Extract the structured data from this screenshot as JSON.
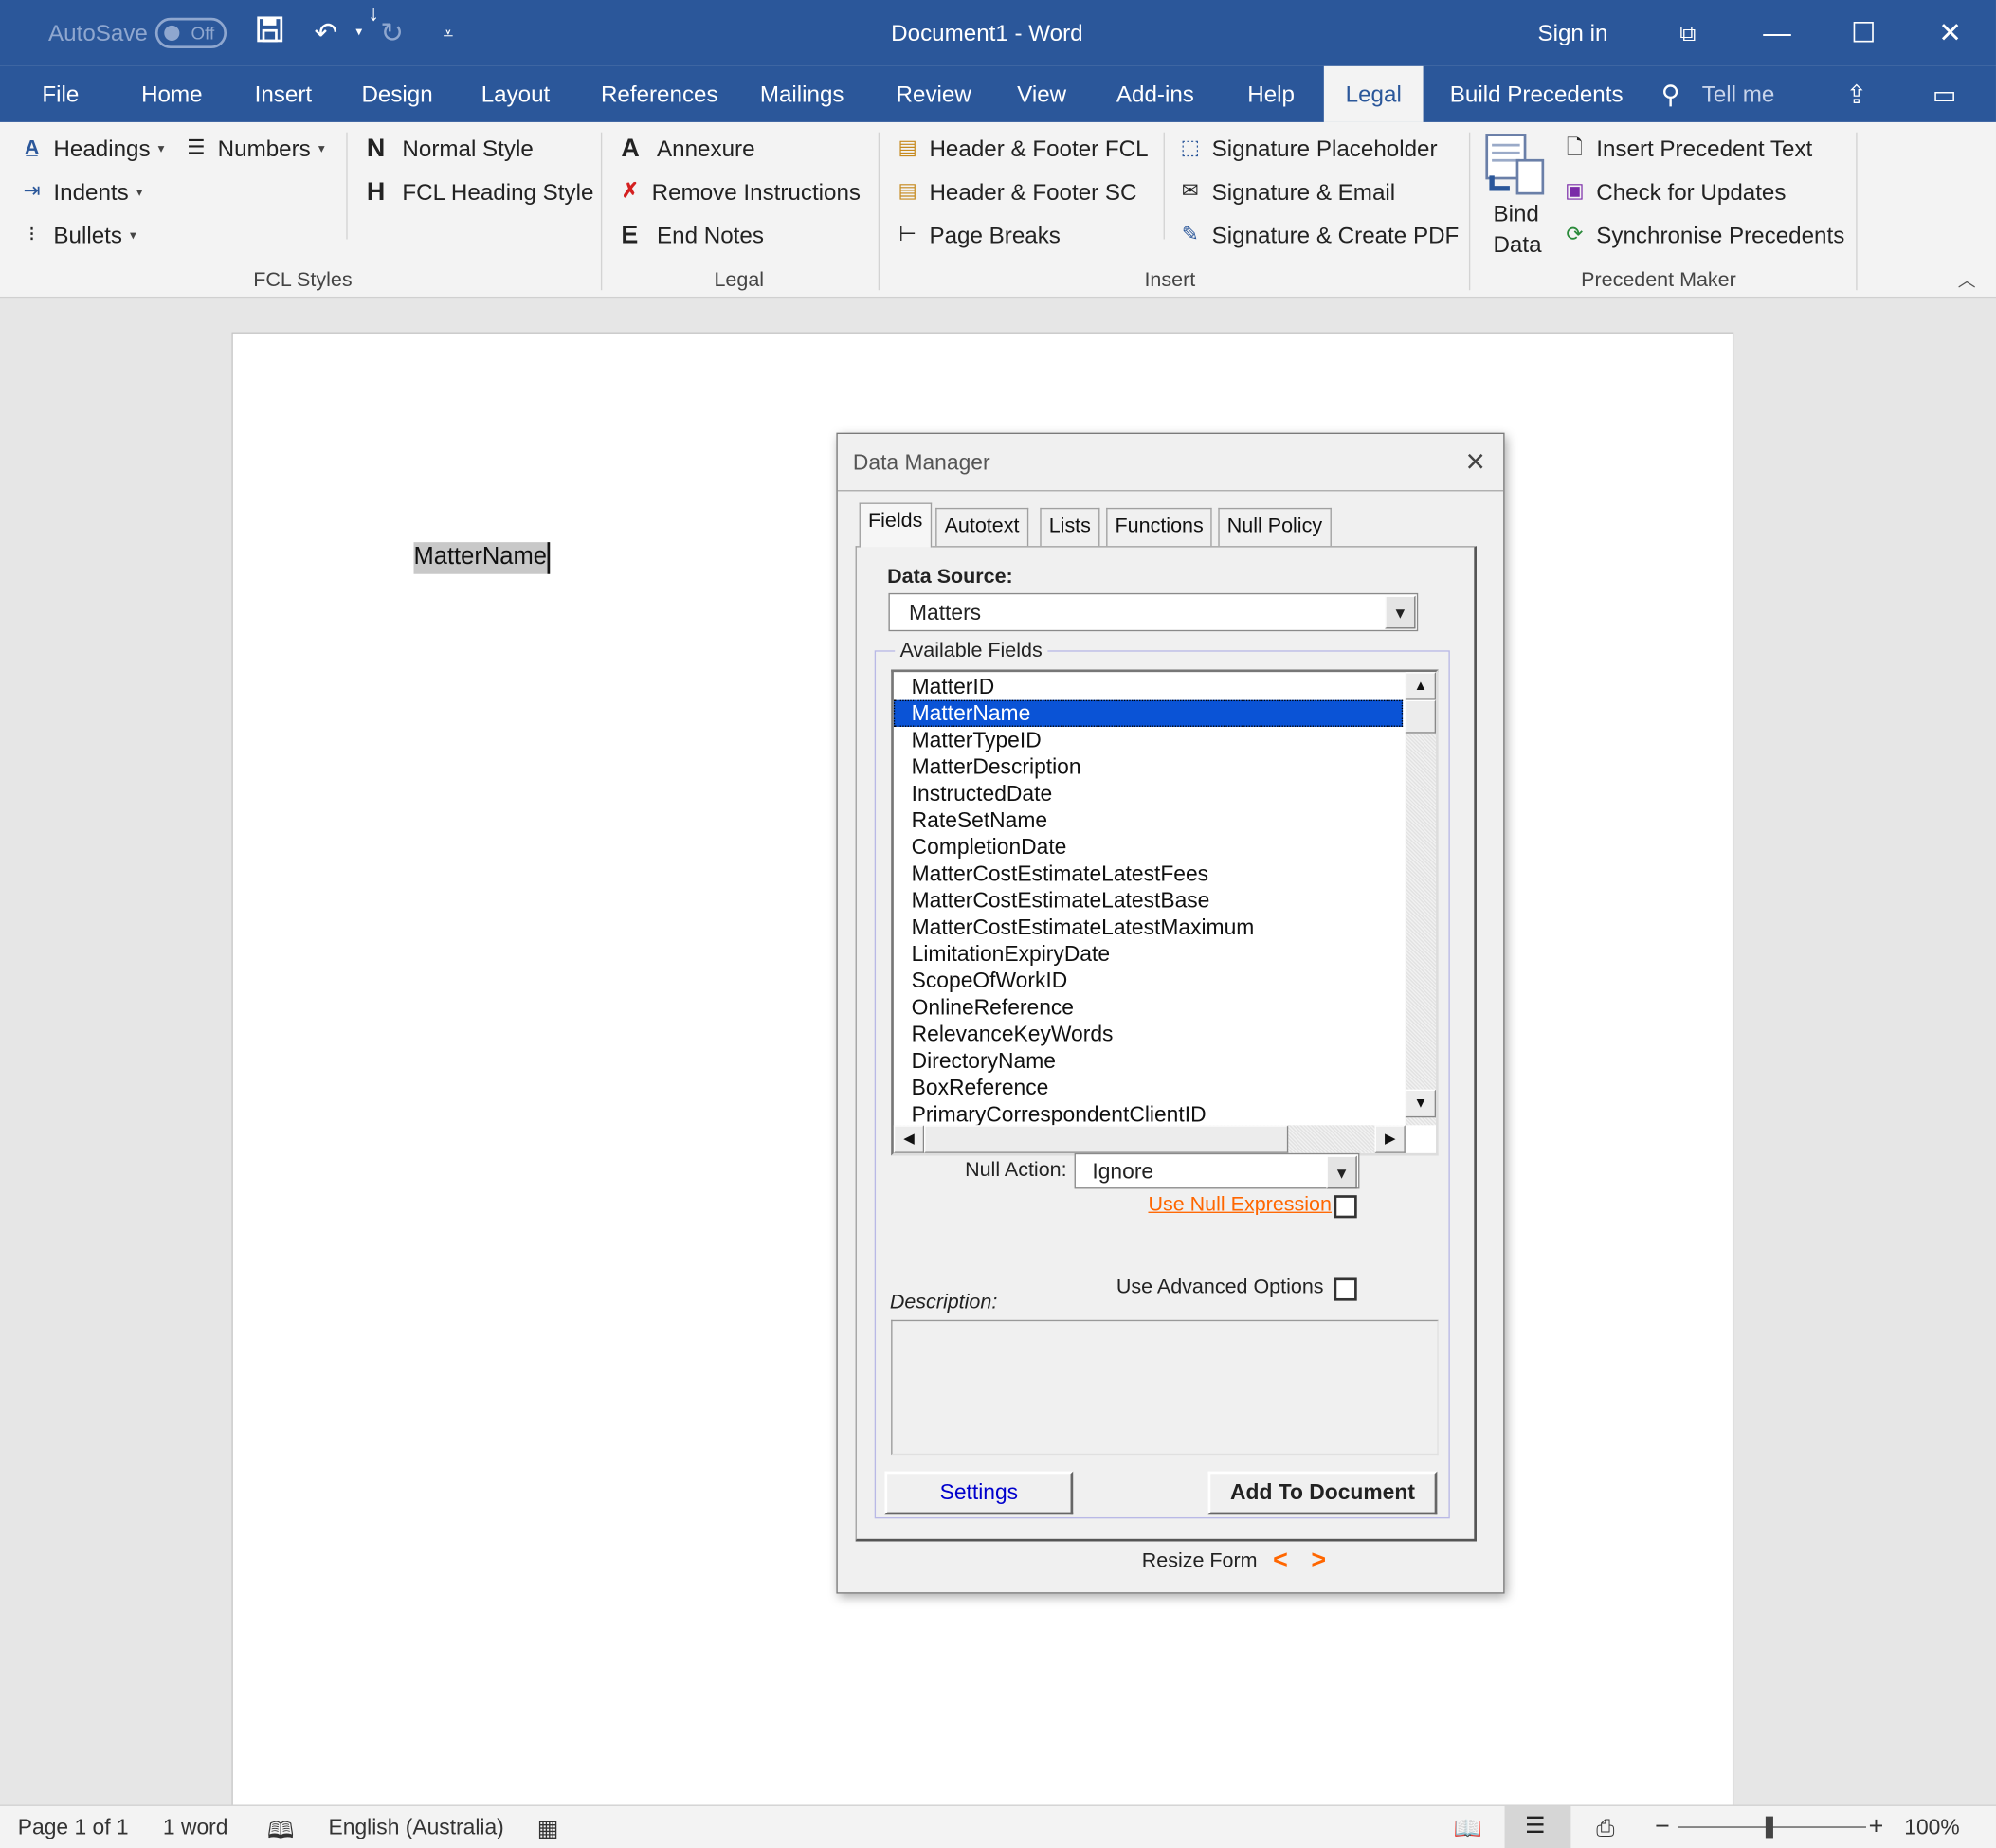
{
  "window": {
    "autosave_label": "AutoSave",
    "autosave_state": "Off",
    "title": "Document1  -  Word",
    "sign_in": "Sign in"
  },
  "ribbon_tabs": [
    "File",
    "Home",
    "Insert",
    "Design",
    "Layout",
    "References",
    "Mailings",
    "Review",
    "View",
    "Add-ins",
    "Help",
    "Legal",
    "Build Precedents"
  ],
  "active_tab": "Legal",
  "tell_me": "Tell me",
  "groups": {
    "fcl_styles": {
      "label": "FCL Styles",
      "headings": "Headings",
      "numbers": "Numbers",
      "indents": "Indents",
      "bullets": "Bullets",
      "normal_style_letter": "N",
      "normal_style": "Normal Style",
      "fcl_heading_letter": "H",
      "fcl_heading_style": "FCL Heading Style"
    },
    "legal": {
      "label": "Legal",
      "annexure_letter": "A",
      "annexure": "Annexure",
      "remove_instructions": "Remove Instructions",
      "end_notes_letter": "E",
      "end_notes": "End Notes"
    },
    "insert": {
      "label": "Insert",
      "header_footer_fcl": "Header & Footer FCL",
      "header_footer_sc": "Header & Footer SC",
      "page_breaks": "Page Breaks",
      "signature_placeholder": "Signature Placeholder",
      "signature_email": "Signature & Email",
      "signature_pdf": "Signature & Create PDF"
    },
    "precedent_maker": {
      "label": "Precedent Maker",
      "bind_data_1": "Bind",
      "bind_data_2": "Data",
      "insert_precedent_text": "Insert Precedent Text",
      "check_updates": "Check for Updates",
      "sync_precedents": "Synchronise Precedents"
    }
  },
  "document": {
    "field_text": "MatterName"
  },
  "dialog": {
    "title": "Data Manager",
    "tabs": [
      "Fields",
      "Autotext",
      "Lists",
      "Functions",
      "Null Policy"
    ],
    "active_tab": "Fields",
    "data_source_label": "Data Source:",
    "data_source_value": "Matters",
    "available_fields_label": "Available Fields",
    "fields": [
      "MatterID",
      "MatterName",
      "MatterTypeID",
      "MatterDescription",
      "InstructedDate",
      "RateSetName",
      "CompletionDate",
      "MatterCostEstimateLatestFees",
      "MatterCostEstimateLatestBase",
      "MatterCostEstimateLatestMaximum",
      "LimitationExpiryDate",
      "ScopeOfWorkID",
      "OnlineReference",
      "RelevanceKeyWords",
      "DirectoryName",
      "BoxReference",
      "PrimaryCorrespondentClientID"
    ],
    "selected_field": "MatterName",
    "null_action_label": "Null Action:",
    "null_action_value": "Ignore",
    "use_null_expression": "Use Null Expression",
    "use_null_expression_checked": false,
    "use_advanced_options": "Use Advanced Options",
    "use_advanced_options_checked": false,
    "description_label": "Description:",
    "description_value": "",
    "settings_button": "Settings",
    "add_button": "Add To Document",
    "resize_label": "Resize Form",
    "resize_left": "<",
    "resize_right": ">"
  },
  "status": {
    "page": "Page 1 of 1",
    "words": "1 word",
    "language": "English (Australia)",
    "zoom": "100%",
    "zoom_level_percent": 100
  },
  "colors": {
    "title_bar": "#2b579a",
    "selection": "#0a53d6",
    "link_orange": "#ff6600",
    "settings_blue": "#0000cc"
  }
}
